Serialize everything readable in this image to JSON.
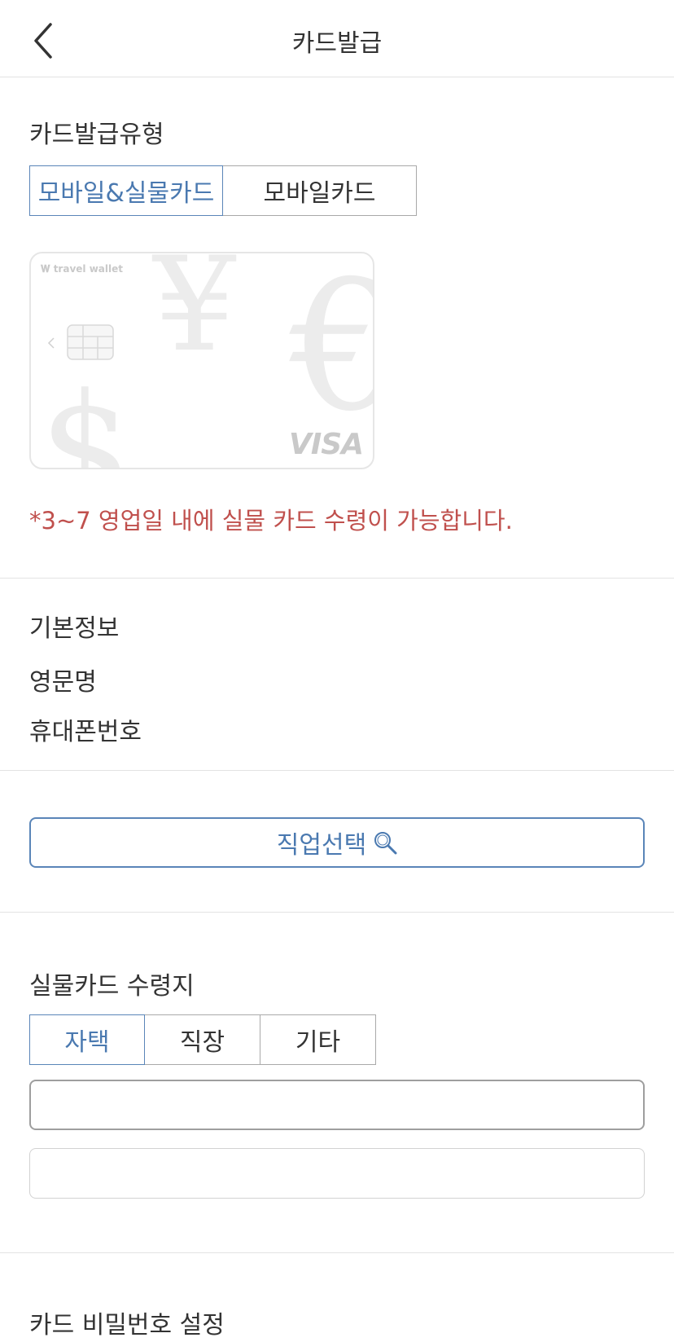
{
  "header": {
    "title": "카드발급"
  },
  "issue_type": {
    "label": "카드발급유형",
    "options": [
      "모바일&실물카드",
      "모바일카드"
    ]
  },
  "card": {
    "brand": "travel wallet",
    "network": "VISA"
  },
  "notice": "*3~7 영업일 내에 실물 카드 수령이 가능합니다.",
  "basic_info": {
    "heading": "기본정보",
    "english_name": "영문명",
    "phone": "휴대폰번호"
  },
  "job": {
    "button_label": "직업선택"
  },
  "receipt": {
    "label": "실물카드 수령지",
    "options": [
      "자택",
      "직장",
      "기타"
    ],
    "address1_value": "",
    "address2_value": ""
  },
  "pin": {
    "label": "카드 비밀번호 설정"
  },
  "colors": {
    "accent": "#4a79b0",
    "notice": "#c0504d"
  }
}
